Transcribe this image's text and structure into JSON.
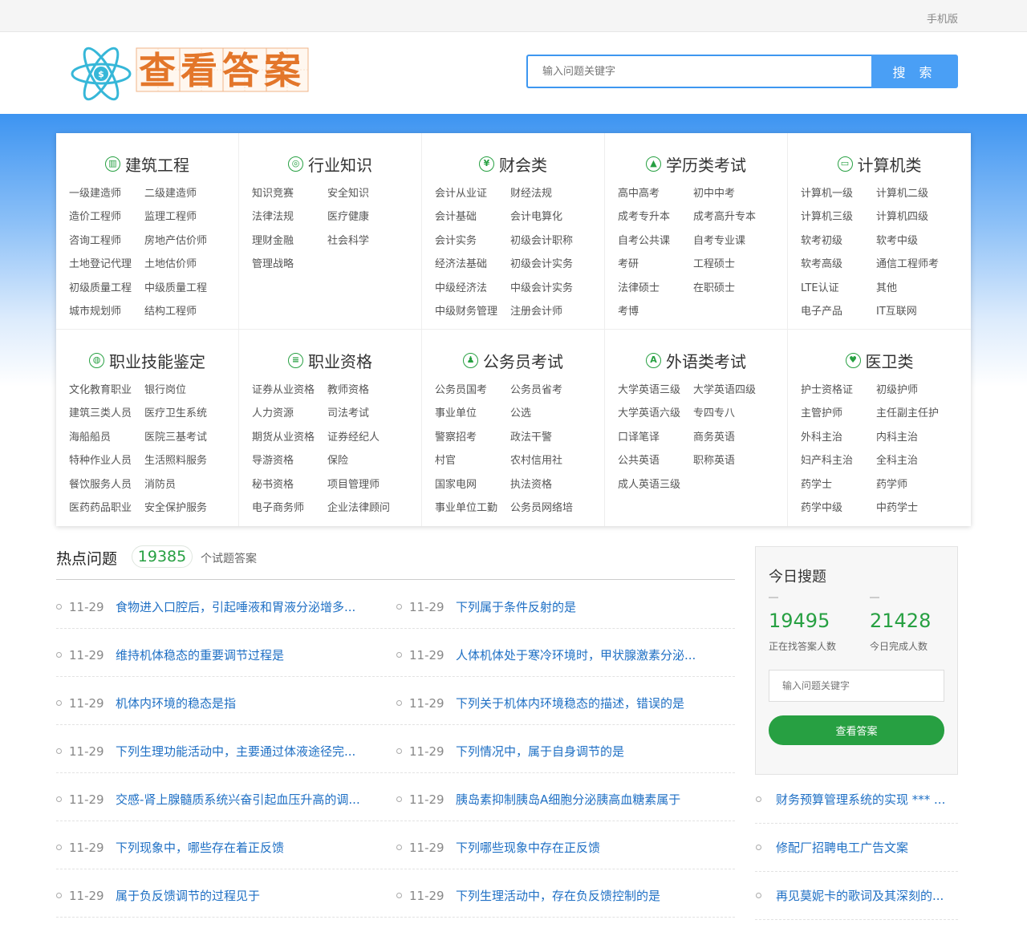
{
  "topbar": {
    "mobile_label": "手机版"
  },
  "header": {
    "logo_text": "查看答案",
    "search_placeholder": "输入问题关键字",
    "search_button": "搜 索"
  },
  "categories": [
    {
      "title": "建筑工程",
      "icon": "building-icon",
      "items": [
        "一级建造师",
        "二级建造师",
        "造价工程师",
        "监理工程师",
        "咨询工程师",
        "房地产估价师",
        "土地登记代理",
        "土地估价师",
        "初级质量工程",
        "中级质量工程",
        "城市规划师",
        "结构工程师"
      ]
    },
    {
      "title": "行业知识",
      "icon": "industry-icon",
      "items": [
        "知识竞赛",
        "安全知识",
        "法律法规",
        "医疗健康",
        "理财金融",
        "社会科学",
        "管理战略"
      ]
    },
    {
      "title": "财会类",
      "icon": "yen-icon",
      "items": [
        "会计从业证",
        "财经法规",
        "会计基础",
        "会计电算化",
        "会计实务",
        "初级会计职称",
        "经济法基础",
        "初级会计实务",
        "中级经济法",
        "中级会计实务",
        "中级财务管理",
        "注册会计师"
      ]
    },
    {
      "title": "学历类考试",
      "icon": "graduation-cap-icon",
      "items": [
        "高中高考",
        "初中中考",
        "成考专升本",
        "成考高升专本",
        "自考公共课",
        "自考专业课",
        "考研",
        "工程硕士",
        "法律硕士",
        "在职硕士",
        "考博"
      ]
    },
    {
      "title": "计算机类",
      "icon": "monitor-icon",
      "items": [
        "计算机一级",
        "计算机二级",
        "计算机三级",
        "计算机四级",
        "软考初级",
        "软考中级",
        "软考高级",
        "通信工程师考",
        "LTE认证",
        "其他",
        "电子产品",
        "IT互联网"
      ]
    },
    {
      "title": "职业技能鉴定",
      "icon": "globe-icon",
      "items": [
        "文化教育职业",
        "银行岗位",
        "建筑三类人员",
        "医疗卫生系统",
        "海船船员",
        "医院三基考试",
        "特种作业人员",
        "生活照料服务",
        "餐饮服务人员",
        "消防员",
        "医药药品职业",
        "安全保护服务"
      ]
    },
    {
      "title": "职业资格",
      "icon": "id-card-icon",
      "items": [
        "证券从业资格",
        "教师资格",
        "人力资源",
        "司法考试",
        "期货从业资格",
        "证券经纪人",
        "导游资格",
        "保险",
        "秘书资格",
        "项目管理师",
        "电子商务师",
        "企业法律顾问"
      ]
    },
    {
      "title": "公务员考试",
      "icon": "person-icon",
      "items": [
        "公务员国考",
        "公务员省考",
        "事业单位",
        "公选",
        "警察招考",
        "政法干警",
        "村官",
        "农村信用社",
        "国家电网",
        "执法资格",
        "事业单位工勤",
        "公务员网络培"
      ]
    },
    {
      "title": "外语类考试",
      "icon": "letter-a-icon",
      "items": [
        "大学英语三级",
        "大学英语四级",
        "大学英语六级",
        "专四专八",
        "口译笔译",
        "商务英语",
        "公共英语",
        "职称英语",
        "成人英语三级"
      ]
    },
    {
      "title": "医卫类",
      "icon": "heart-icon",
      "items": [
        "护士资格证",
        "初级护师",
        "主管护师",
        "主任副主任护",
        "外科主治",
        "内科主治",
        "妇产科主治",
        "全科主治",
        "药学士",
        "药学师",
        "药学中级",
        "中药学士"
      ]
    }
  ],
  "hot": {
    "title": "热点问题",
    "count": "19385",
    "suffix": "个试题答案"
  },
  "questions": [
    {
      "left": {
        "date": "11-29",
        "text": "食物进入口腔后，引起唾液和胃液分泌增多..."
      },
      "right": {
        "date": "11-29",
        "text": "下列属于条件反射的是"
      }
    },
    {
      "left": {
        "date": "11-29",
        "text": "维持机体稳态的重要调节过程是"
      },
      "right": {
        "date": "11-29",
        "text": "人体机体处于寒冷环境时，甲状腺激素分泌..."
      }
    },
    {
      "left": {
        "date": "11-29",
        "text": "机体内环境的稳态是指"
      },
      "right": {
        "date": "11-29",
        "text": "下列关于机体内环境稳态的描述，错误的是"
      }
    },
    {
      "left": {
        "date": "11-29",
        "text": "下列生理功能活动中，主要通过体液途径完..."
      },
      "right": {
        "date": "11-29",
        "text": "下列情况中，属于自身调节的是"
      }
    },
    {
      "left": {
        "date": "11-29",
        "text": "交感-肾上腺髓质系统兴奋引起血压升高的调..."
      },
      "right": {
        "date": "11-29",
        "text": "胰岛素抑制胰岛A细胞分泌胰高血糖素属于"
      }
    },
    {
      "left": {
        "date": "11-29",
        "text": "下列现象中，哪些存在着正反馈"
      },
      "right": {
        "date": "11-29",
        "text": "下列哪些现象中存在正反馈"
      }
    },
    {
      "left": {
        "date": "11-29",
        "text": "属于负反馈调节的过程见于"
      },
      "right": {
        "date": "11-29",
        "text": "下列生理活动中，存在负反馈控制的是"
      }
    }
  ],
  "today": {
    "title": "今日搜题",
    "searching_count": "19495",
    "searching_label": "正在找答案人数",
    "done_count": "21428",
    "done_label": "今日完成人数",
    "input_placeholder": "输入问题关键字",
    "button": "查看答案"
  },
  "sidebar_links": [
    "财务预算管理系统的实现 *** ...",
    "修配厂招聘电工广告文案",
    "再见莫妮卡的歌词及其深刻的..."
  ],
  "colors": {
    "primary_blue": "#4a9ff5",
    "green": "#27a042",
    "link_blue": "#1e6fc4",
    "logo_orange": "#e3762a",
    "logo_cyan": "#36b7d8"
  }
}
